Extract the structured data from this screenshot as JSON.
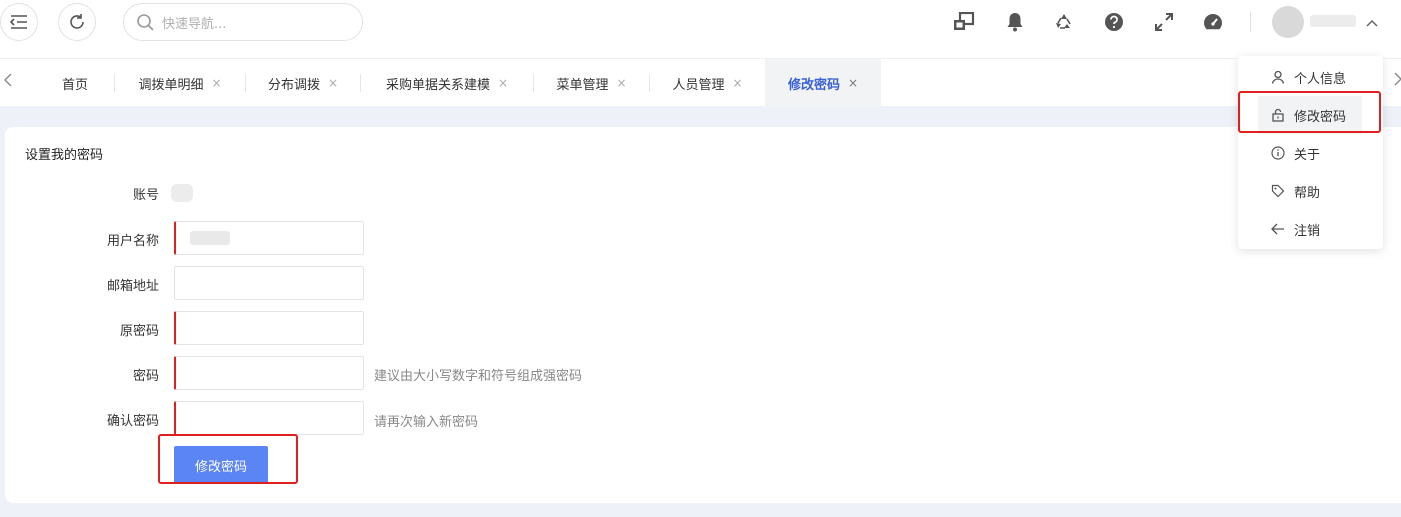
{
  "header": {
    "search_placeholder": "快速导航...",
    "user_name_tail": "ᐧ"
  },
  "tabs": [
    {
      "label": "首页",
      "closable": false
    },
    {
      "label": "调拨单明细",
      "closable": true
    },
    {
      "label": "分布调拨",
      "closable": true
    },
    {
      "label": "采购单据关系建模",
      "closable": true
    },
    {
      "label": "菜单管理",
      "closable": true
    },
    {
      "label": "人员管理",
      "closable": true
    },
    {
      "label": "修改密码",
      "closable": true,
      "active": true
    }
  ],
  "close_glyph": "×",
  "form": {
    "title": "设置我的密码",
    "account_label": "账号",
    "username_label": "用户名称",
    "email_label": "邮箱地址",
    "old_password_label": "原密码",
    "password_label": "密码",
    "password_hint": "建议由大小写数字和符号组成强密码",
    "confirm_label": "确认密码",
    "confirm_hint": "请再次输入新密码",
    "submit_label": "修改密码"
  },
  "dropdown": {
    "items": [
      {
        "label": "个人信息",
        "icon": "user-icon"
      },
      {
        "label": "修改密码",
        "icon": "lock-icon",
        "active": true
      },
      {
        "label": "关于",
        "icon": "info-icon"
      },
      {
        "label": "帮助",
        "icon": "tag-icon"
      },
      {
        "label": "注销",
        "icon": "arrow-left-icon"
      }
    ]
  },
  "colors": {
    "accent": "#3a62d7",
    "button": "#5b84f5",
    "highlight": "#e02020",
    "background": "#eef1f8"
  }
}
